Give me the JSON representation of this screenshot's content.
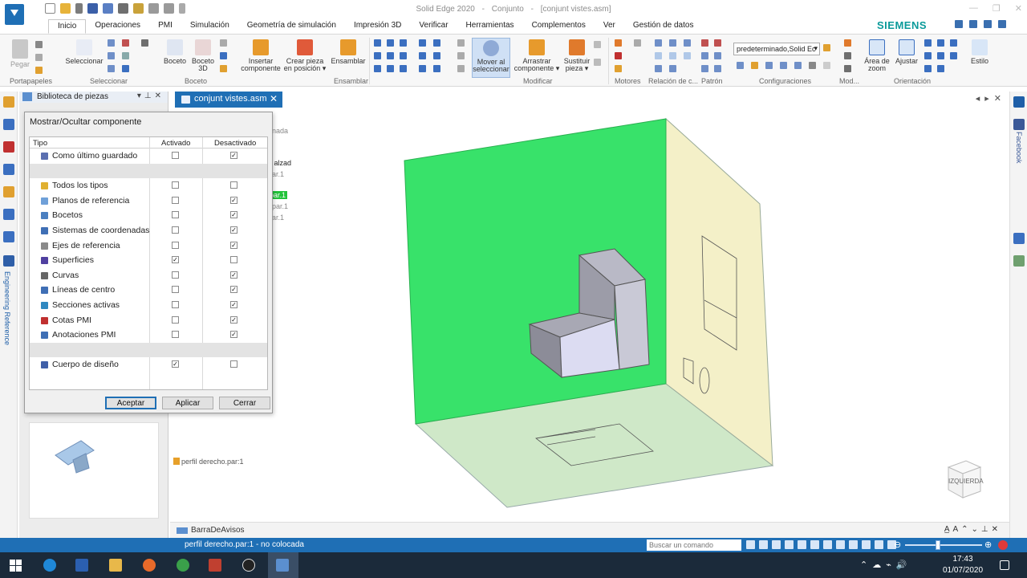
{
  "window": {
    "title_parts": [
      "Solid Edge 2020",
      "-",
      "Conjunto",
      "-",
      "[conjunt vistes.asm]"
    ]
  },
  "menu_tabs": [
    "Inicio",
    "Operaciones",
    "PMI",
    "Simulación",
    "Geometría de simulación",
    "Impresión 3D",
    "Verificar",
    "Herramientas",
    "Complementos",
    "Ver",
    "Gestión de datos"
  ],
  "active_menu_tab": "Inicio",
  "brand": "SIEMENS",
  "ribbon": {
    "buttons": {
      "pegar": "Pegar",
      "seleccionar": "Seleccionar",
      "boceto": "Boceto",
      "boceto3d_1": "Boceto",
      "boceto3d_2": "3D",
      "insertar_1": "Insertar",
      "insertar_2": "componente",
      "crear_1": "Crear pieza",
      "crear_2": "en posición ▾",
      "ensamblar": "Ensamblar",
      "mover_1": "Mover al",
      "mover_2": "seleccionar",
      "arrastrar_1": "Arrastrar",
      "arrastrar_2": "componente ▾",
      "sustituir_1": "Sustituir",
      "sustituir_2": "pieza ▾",
      "area_zoom_1": "Área de",
      "area_zoom_2": "zoom",
      "ajustar": "Ajustar",
      "estilo": "Estilo"
    },
    "groups": {
      "portapapeles": "Portapapeles",
      "seleccionar": "Seleccionar",
      "boceto": "Boceto",
      "ensamblar": "Ensamblar",
      "modificar": "Modificar",
      "motores": "Motores",
      "relacion": "Relación de c...",
      "patron": "Patrón",
      "configuraciones": "Configuraciones",
      "mod": "Mod...",
      "orientacion": "Orientación"
    },
    "config_value": "predeterminado,Solid Ec"
  },
  "library_panel": {
    "title": "Biblioteca de piezas"
  },
  "rail": {
    "engineering_reference": "Engineering Reference",
    "facebook": "Facebook"
  },
  "document_tab": {
    "label": "conjunt vistes.asm"
  },
  "viewport": {
    "tree_ghost": [
      "enada",
      "a",
      "o alzad",
      "par.1",
      "par.1",
      "r.par.1",
      "par.1"
    ],
    "part_label": "perfil derecho.par:1",
    "view_cube_label": "IZQUIERDA"
  },
  "dialog": {
    "title": "Mostrar/Ocultar componente",
    "headers": {
      "tipo": "Tipo",
      "activado": "Activado",
      "desactivado": "Desactivado"
    },
    "rows": [
      {
        "label": "Como último guardado",
        "on": false,
        "off": true,
        "icon": "#5b6fb0"
      },
      {
        "label": "",
        "separator": true
      },
      {
        "label": "Todos los tipos",
        "on": false,
        "off": false,
        "icon": "#e0b030"
      },
      {
        "label": "Planos de referencia",
        "on": false,
        "off": true,
        "icon": "#6fa0d8"
      },
      {
        "label": "Bocetos",
        "on": false,
        "off": true,
        "icon": "#4a7fc0"
      },
      {
        "label": "Sistemas de coordenadas",
        "on": false,
        "off": true,
        "icon": "#3f6fb5"
      },
      {
        "label": "Ejes de referencia",
        "on": false,
        "off": true,
        "icon": "#8a8a8a"
      },
      {
        "label": "Superficies",
        "on": true,
        "off": false,
        "icon": "#5040a0"
      },
      {
        "label": "Curvas",
        "on": false,
        "off": true,
        "icon": "#666666"
      },
      {
        "label": "Líneas de centro",
        "on": false,
        "off": true,
        "icon": "#3f6fb5"
      },
      {
        "label": "Secciones activas",
        "on": false,
        "off": true,
        "icon": "#2f88c0"
      },
      {
        "label": "Cotas PMI",
        "on": false,
        "off": true,
        "icon": "#c03030"
      },
      {
        "label": "Anotaciones PMI",
        "on": false,
        "off": true,
        "icon": "#3f6fb5"
      },
      {
        "label": "",
        "separator": true
      },
      {
        "label": "Cuerpo de diseño",
        "on": true,
        "off": false,
        "icon": "#4060a8"
      }
    ],
    "buttons": {
      "accept": "Aceptar",
      "apply": "Aplicar",
      "close": "Cerrar"
    }
  },
  "notification_bar": {
    "label": "BarraDeAvisos"
  },
  "status_bar": {
    "message": "perfil derecho.par:1 - no colocada",
    "search_placeholder": "Buscar un comando"
  },
  "taskbar": {
    "time": "17:43",
    "date": "01/07/2020"
  },
  "colors": {
    "accent": "#1f6fb5",
    "green_plane": "#38e26a",
    "yellow_plane": "#f4f0c8",
    "floor_plane": "#cfe8c8",
    "part": "#dcdcf2"
  }
}
